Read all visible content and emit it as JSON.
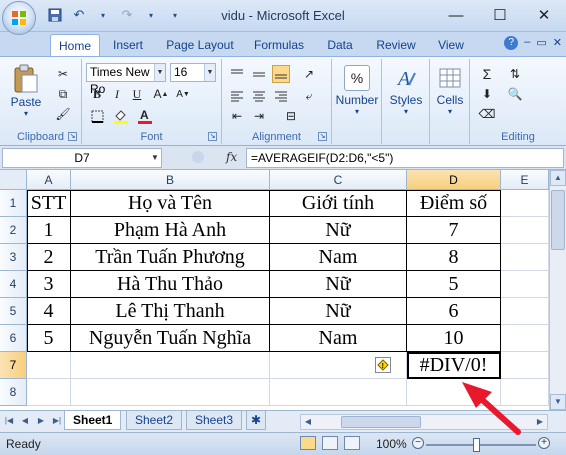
{
  "window": {
    "title": "vidu - Microsoft Excel",
    "controls": {
      "minimize": "—",
      "maximize": "☐",
      "close": "✕"
    }
  },
  "ribbon": {
    "tabs": [
      "Home",
      "Insert",
      "Page Layout",
      "Formulas",
      "Data",
      "Review",
      "View"
    ],
    "active_tab": "Home",
    "font_name": "Times New Ro",
    "font_size": "16",
    "groups": {
      "clipboard": "Clipboard",
      "font": "Font",
      "alignment": "Alignment",
      "editing": "Editing"
    },
    "buttons": {
      "paste": "Paste",
      "number": "Number",
      "styles": "Styles",
      "cells": "Cells",
      "bold": "B",
      "italic": "I",
      "underline": "U",
      "percent": "%"
    }
  },
  "formula_bar": {
    "name_box": "D7",
    "fx": "fx",
    "formula": "=AVERAGEIF(D2:D6,\"<5\")"
  },
  "grid": {
    "columns": [
      "A",
      "B",
      "C",
      "D",
      "E"
    ],
    "selected_column": "D",
    "rows": [
      "1",
      "2",
      "3",
      "4",
      "5",
      "6",
      "7",
      "8"
    ],
    "selected_row": "7",
    "header": [
      "STT",
      "Họ và Tên",
      "Giới tính",
      "Điểm số"
    ],
    "data": [
      [
        "1",
        "Phạm Hà Anh",
        "Nữ",
        "7"
      ],
      [
        "2",
        "Trần Tuấn Phương",
        "Nam",
        "8"
      ],
      [
        "3",
        "Hà Thu Thảo",
        "Nữ",
        "5"
      ],
      [
        "4",
        "Lê Thị Thanh",
        "Nữ",
        "6"
      ],
      [
        "5",
        "Nguyễn Tuấn Nghĩa",
        "Nam",
        "10"
      ]
    ],
    "result_cell": "#DIV/0!",
    "error_icon": "!"
  },
  "sheets": {
    "tabs": [
      "Sheet1",
      "Sheet2",
      "Sheet3"
    ],
    "active": "Sheet1"
  },
  "status": {
    "ready": "Ready",
    "zoom": "100%",
    "zoom_fraction": 0.5
  },
  "colors": {
    "accent_arrow": "#e8192c",
    "selected_header": "#f8cf7d"
  }
}
